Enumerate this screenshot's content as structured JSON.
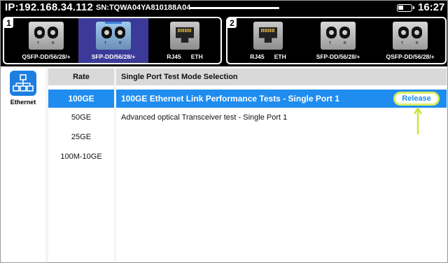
{
  "status_bar": {
    "ip": "IP:192.168.34.112",
    "serial": "SN:TQWA04YA810188A04",
    "time": "16:27"
  },
  "port_groups": [
    {
      "number": "1",
      "ports": [
        {
          "label": "QSFP-DD/56/28/+",
          "icon": "qsfp-port-icon",
          "selected": false
        },
        {
          "label": "SFP-DD/56/28/+",
          "icon": "sfp-port-icon",
          "selected": true
        },
        {
          "label": "RJ45      ETH",
          "icon": "rj45-port-icon",
          "selected": false
        }
      ]
    },
    {
      "number": "2",
      "ports": [
        {
          "label": "RJ45      ETH",
          "icon": "rj45-port-icon",
          "selected": false
        },
        {
          "label": "SFP-DD/56/28/+",
          "icon": "sfp-port-icon",
          "selected": false
        },
        {
          "label": "QSFP-DD/56/28/+",
          "icon": "qsfp-port-icon",
          "selected": false
        }
      ]
    }
  ],
  "sidebar": {
    "ethernet_label": "Ethernet",
    "icon": "network-topology-icon"
  },
  "rate_panel": {
    "header": "Rate",
    "items": [
      "100GE",
      "50GE",
      "25GE",
      "100M-10GE"
    ],
    "selected_index": 0
  },
  "mode_panel": {
    "header": "Single Port Test Mode Selection",
    "items": [
      "100GE Ethernet Link Performance Tests - Single Port 1",
      "Advanced optical Transceiver test - Single Port 1"
    ],
    "selected_index": 0,
    "release_label": "Release"
  },
  "colors": {
    "accent_blue": "#1f8cf0",
    "selected_port": "#3b3a98",
    "highlight_green": "#d6ef60"
  }
}
